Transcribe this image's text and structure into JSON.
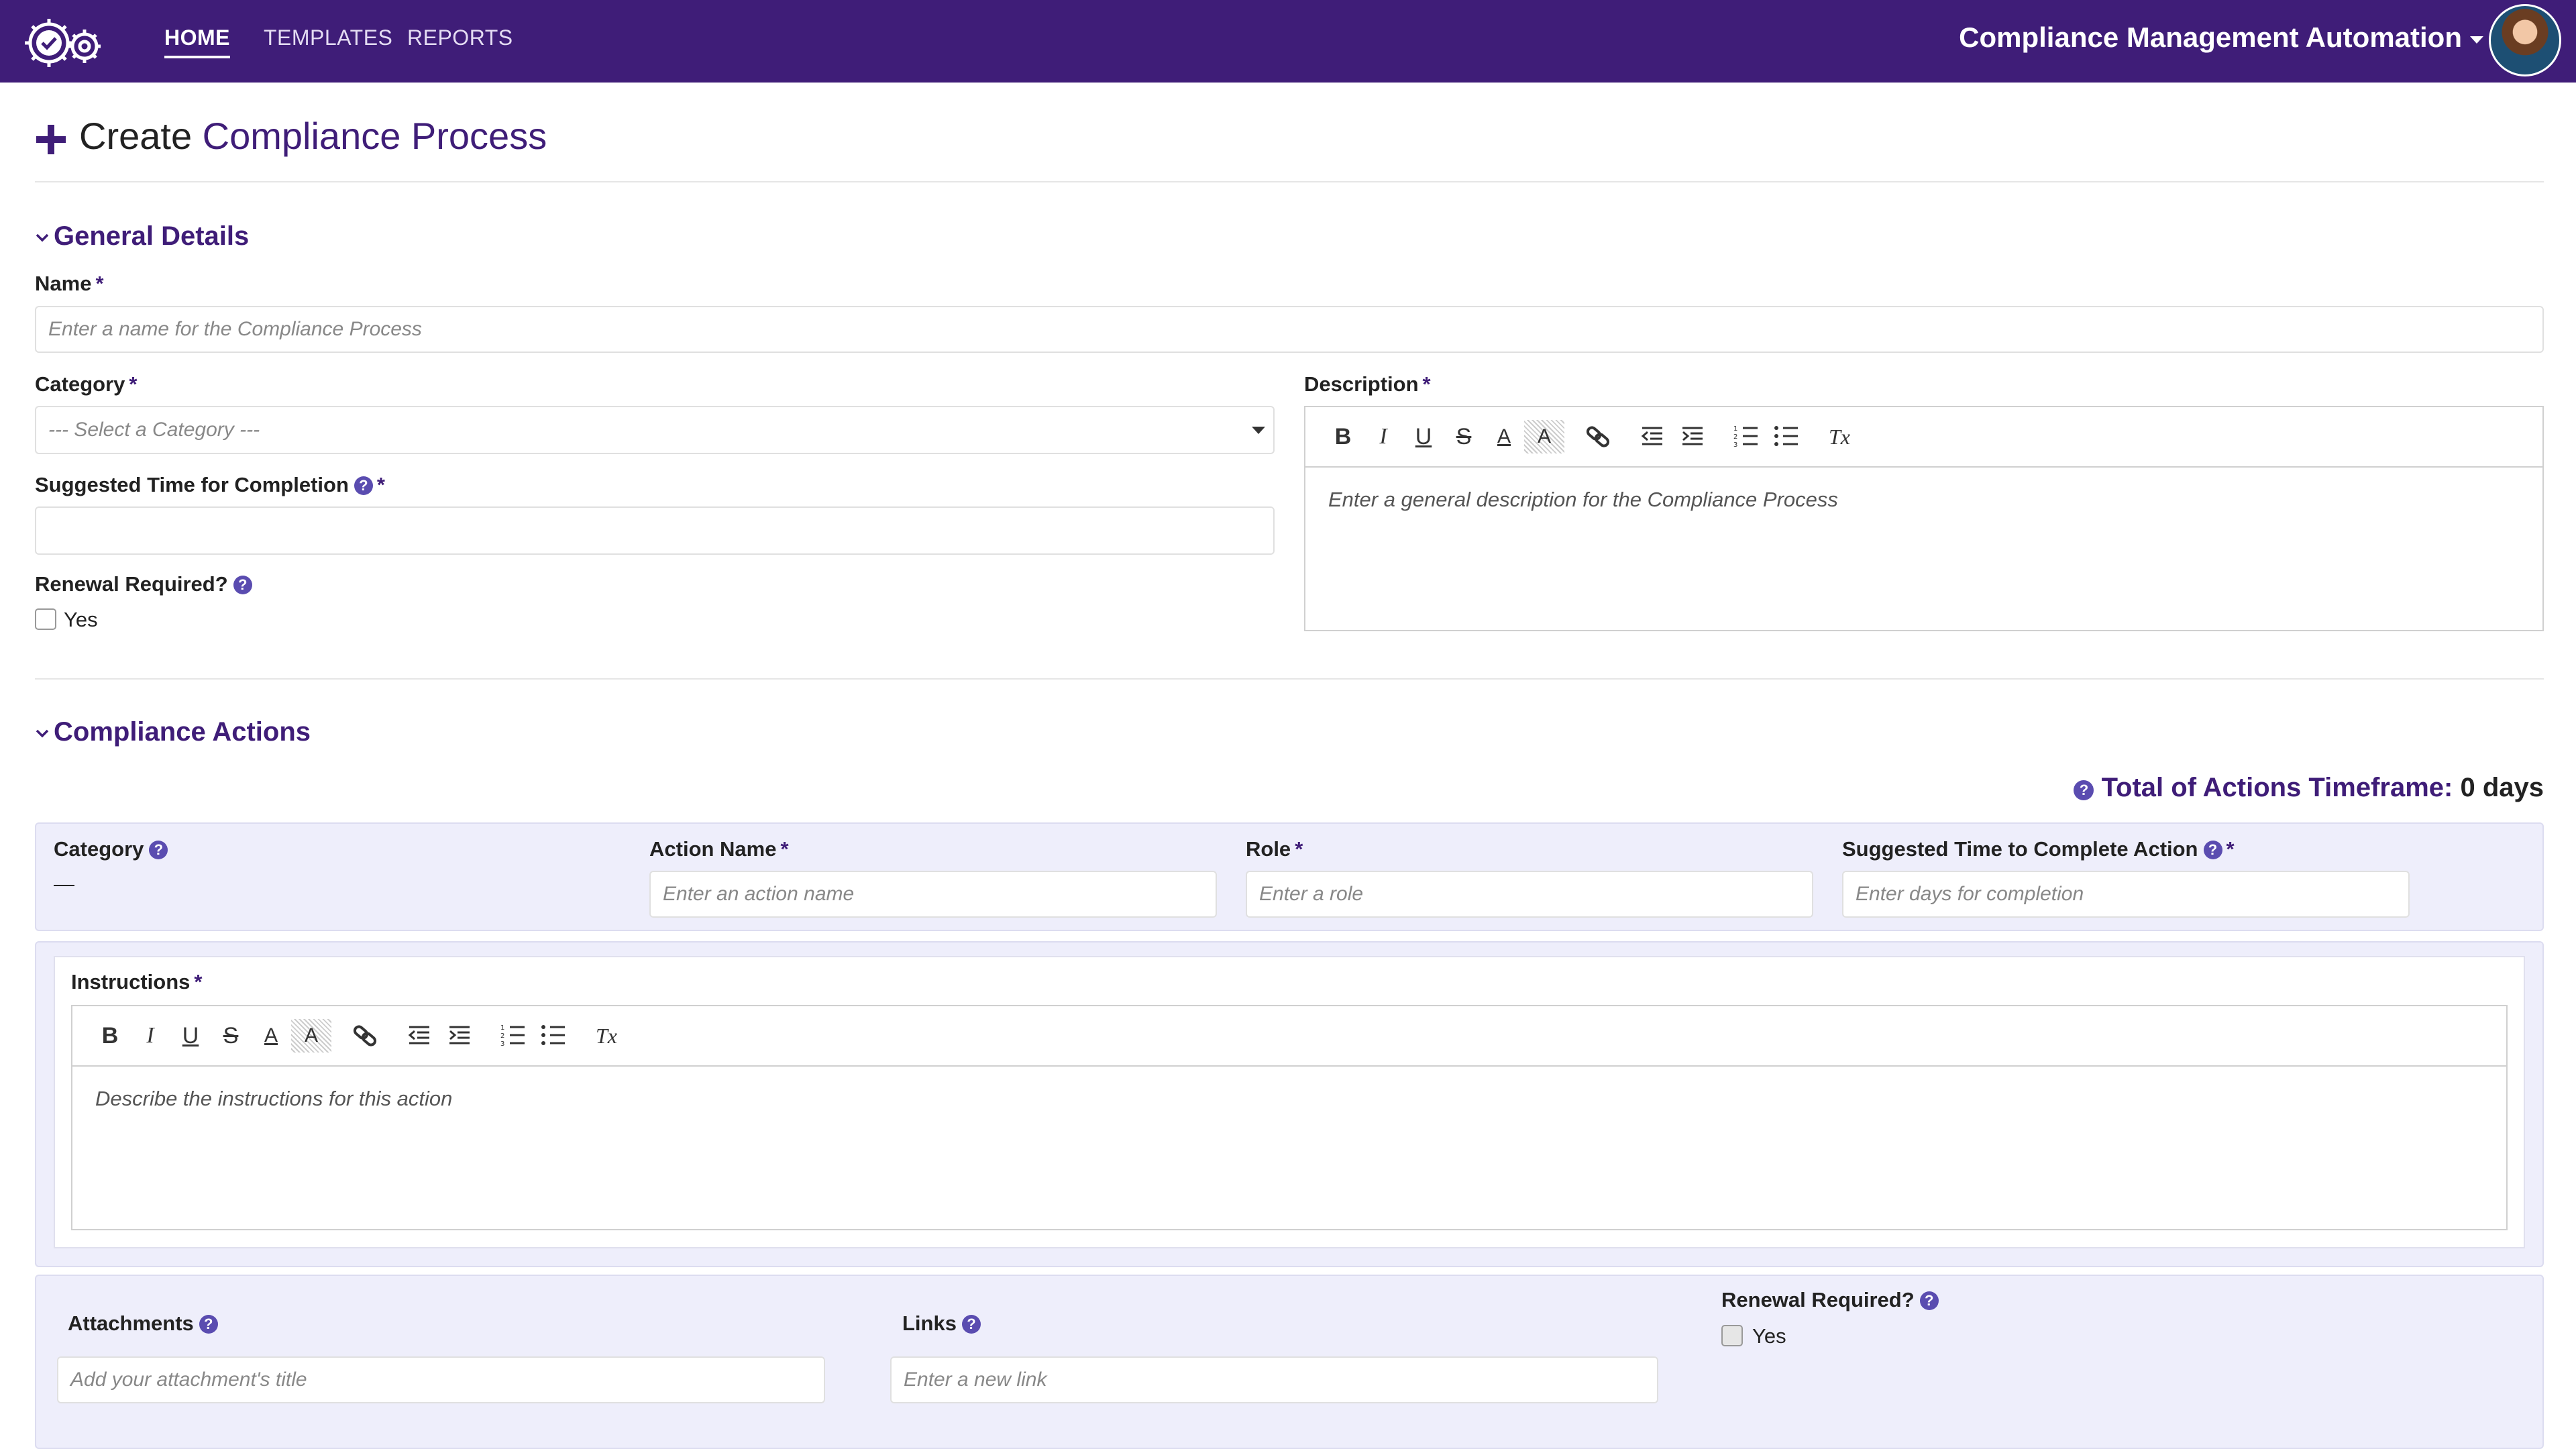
{
  "nav": {
    "links": [
      "HOME",
      "TEMPLATES",
      "REPORTS"
    ],
    "app_title": "Compliance Management Automation"
  },
  "page": {
    "title_prefix": "Create",
    "title_accent": "Compliance Process"
  },
  "general": {
    "title": "General Details",
    "name_label": "Name",
    "name_placeholder": "Enter a name for the Compliance Process",
    "category_label": "Category",
    "category_selected": "--- Select a Category ---",
    "suggested_label": "Suggested Time for Completion",
    "renewal_label": "Renewal Required?",
    "renewal_option": "Yes",
    "description_label": "Description",
    "description_placeholder": "Enter a general description for the Compliance Process"
  },
  "actions": {
    "title": "Compliance Actions",
    "total_label": "Total of Actions Timeframe:",
    "total_value": "0 days",
    "category_label": "Category",
    "category_value": "—",
    "action_name_label": "Action Name",
    "action_name_placeholder": "Enter an action name",
    "role_label": "Role",
    "role_placeholder": "Enter a role",
    "suggested_label": "Suggested Time to Complete Action",
    "suggested_placeholder": "Enter days for completion",
    "instructions_label": "Instructions",
    "instructions_placeholder": "Describe the instructions for this action",
    "attachments_label": "Attachments",
    "attachments_placeholder": "Add your attachment's title",
    "links_label": "Links",
    "links_placeholder": "Enter a new link",
    "renewal_label": "Renewal Required?",
    "renewal_option": "Yes"
  },
  "toolbar": {
    "bold": "B",
    "italic": "I",
    "underline": "U",
    "strike": "S",
    "color": "A",
    "highlight": "A",
    "clear": "Tx"
  },
  "colors": {
    "brand": "#3f1d78",
    "help": "#5a4cb0",
    "panel": "#eeeefb"
  },
  "icons": [
    "gear-check-logo-icon",
    "plus-icon",
    "chevron-down-icon",
    "help-icon",
    "link-icon",
    "outdent-icon",
    "indent-icon",
    "ordered-list-icon",
    "bullet-list-icon",
    "clear-format-icon"
  ]
}
